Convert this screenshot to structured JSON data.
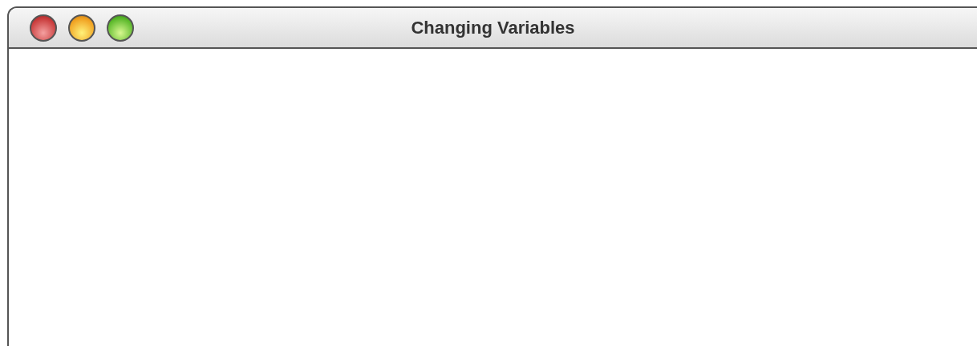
{
  "window": {
    "title": "Changing Variables"
  }
}
